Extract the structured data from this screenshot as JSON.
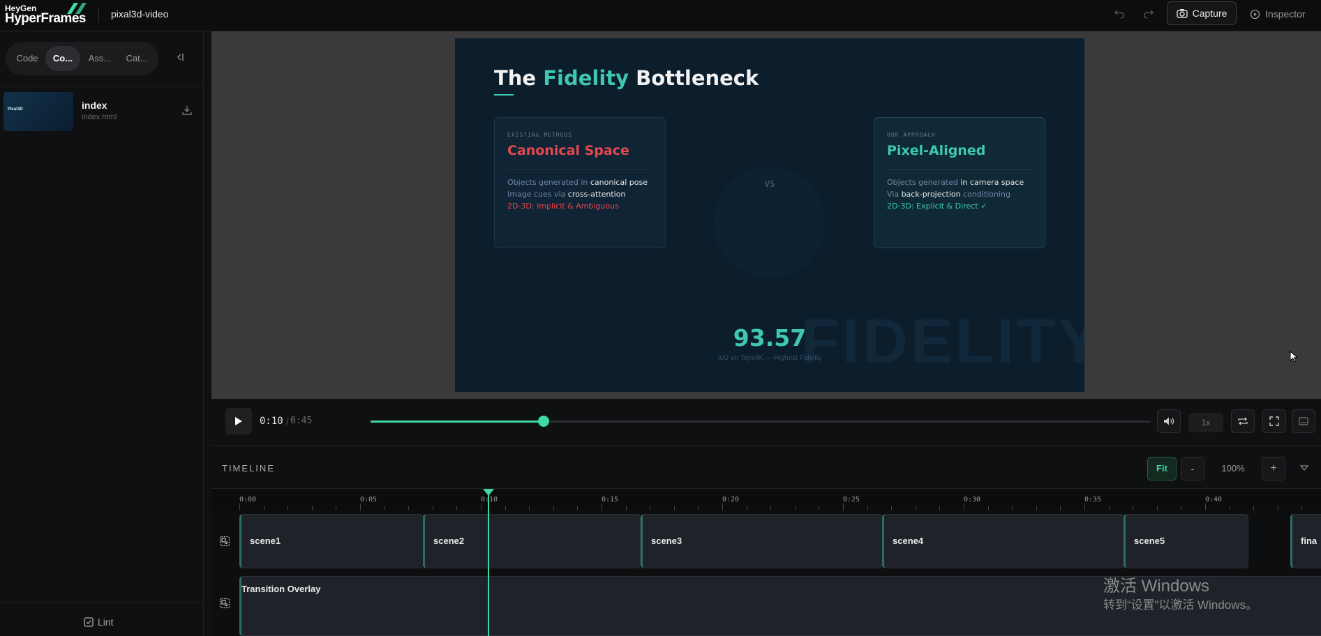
{
  "app": {
    "brand_small": "HeyGen",
    "brand_big": "HyperFrames",
    "project_name": "pixal3d-video",
    "capture_label": "Capture",
    "inspector_label": "Inspector",
    "accent_color": "#3fd9a8"
  },
  "sidebar": {
    "tabs": [
      {
        "label": "Code"
      },
      {
        "label": "Co..."
      },
      {
        "label": "Ass..."
      },
      {
        "label": "Cat..."
      }
    ],
    "active_tab": "Co...",
    "file": {
      "name": "index",
      "path": "index.html",
      "thumb_text": "Pixal3D"
    },
    "lint_label": "Lint"
  },
  "slide": {
    "title_pre": "The ",
    "title_highlight": "Fidelity",
    "title_post": " Bottleneck",
    "left_card": {
      "kicker": "EXISTING METHODS",
      "title": "Canonical Space",
      "line1_pre": "Objects generated in ",
      "line1_em": "canonical pose",
      "line2_pre": "Image cues via ",
      "line2_em": "cross-attention",
      "line3": "2D-3D: Implicit & Ambiguous",
      "title_color": "#e5484d"
    },
    "vs": "VS",
    "right_card": {
      "kicker": "OUR APPROACH",
      "title": "Pixel-Aligned",
      "line1_pre": "Objects generated ",
      "line1_em": "in camera space",
      "line2_pre": "Via ",
      "line2_em": "back-projection",
      "line2_post": " conditioning",
      "line3": "2D-3D: Explicit & Direct ✓",
      "title_color": "#3fc7b3"
    },
    "metric_value": "93.57",
    "metric_caption": "IoU on Toys4K — Highest Fidelity",
    "watermark": "FIDELITY"
  },
  "player": {
    "current_time": "0:10",
    "separator": "/",
    "total_time": "0:45",
    "progress": 0.2222,
    "speed": "1x"
  },
  "timeline": {
    "label": "TIMELINE",
    "fit_label": "Fit",
    "zoom_out_label": "-",
    "zoom_level": "100%",
    "zoom_in_label": "+",
    "ticks": [
      "0:00",
      "0:05",
      "0:10",
      "0:15",
      "0:20",
      "0:25",
      "0:30",
      "0:35",
      "0:40"
    ],
    "playhead_seconds": 10,
    "clips": [
      {
        "label": "scene1"
      },
      {
        "label": "scene2"
      },
      {
        "label": "scene3"
      },
      {
        "label": "scene4"
      },
      {
        "label": "scene5"
      },
      {
        "label": "fina"
      }
    ],
    "overlay_label": "Transition Overlay"
  },
  "os_watermark": {
    "line1": "激活 Windows",
    "line2": "转到“设置”以激活 Windows。"
  }
}
